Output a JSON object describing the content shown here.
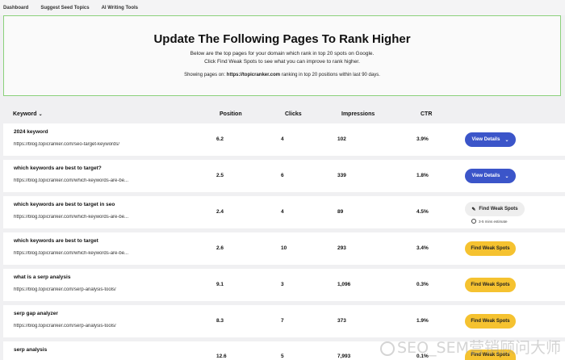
{
  "nav": {
    "items": [
      "Dashboard",
      "Suggest Seed Topics",
      "AI Writing Tools"
    ]
  },
  "hero": {
    "title": "Update The Following Pages To Rank Higher",
    "line1": "Below are the top pages for your domain which rank in top 20 spots on Google.",
    "line2": "Click Find Weak Spots to see what you can improve to rank higher.",
    "filter_prefix": "Showing pages on:",
    "filter_domain": "https://topicranker.com",
    "filter_suffix": "ranking in top 20 positions within last 90 days."
  },
  "table": {
    "headers": {
      "keyword": "Keyword",
      "position": "Position",
      "clicks": "Clicks",
      "impressions": "Impressions",
      "ctr": "CTR"
    },
    "rows": [
      {
        "keyword": "2024 keyword",
        "url": "https://blog.topicranker.com/seo-target-keywords/",
        "position": "6.2",
        "clicks": "4",
        "impressions": "102",
        "ctr": "3.9%",
        "action": "View Details",
        "style": "blue"
      },
      {
        "keyword": "which keywords are best to target?",
        "url": "https://blog.topicranker.com/which-keywords-are-be...",
        "position": "2.5",
        "clicks": "6",
        "impressions": "339",
        "ctr": "1.8%",
        "action": "View Details",
        "style": "blue"
      },
      {
        "keyword": "which keywords are best to target in seo",
        "url": "https://blog.topicranker.com/which-keywords-are-be...",
        "position": "2.4",
        "clicks": "4",
        "impressions": "89",
        "ctr": "4.5%",
        "action": "Find Weak Spots",
        "style": "gray",
        "estimate": "3-5 mins estimate"
      },
      {
        "keyword": "which keywords are best to target",
        "url": "https://blog.topicranker.com/which-keywords-are-be...",
        "position": "2.6",
        "clicks": "10",
        "impressions": "293",
        "ctr": "3.4%",
        "action": "Find Weak Spots",
        "style": "yellow"
      },
      {
        "keyword": "what is a serp analysis",
        "url": "https://blog.topicranker.com/serp-analysis-tools/",
        "position": "9.1",
        "clicks": "3",
        "impressions": "1,096",
        "ctr": "0.3%",
        "action": "Find Weak Spots",
        "style": "yellow"
      },
      {
        "keyword": "serp gap analyzer",
        "url": "https://blog.topicranker.com/serp-analysis-tools/",
        "position": "8.3",
        "clicks": "7",
        "impressions": "373",
        "ctr": "1.9%",
        "action": "Find Weak Spots",
        "style": "yellow"
      },
      {
        "keyword": "serp analysis",
        "url": "",
        "position": "12.6",
        "clicks": "5",
        "impressions": "7,993",
        "ctr": "0.1%",
        "action": "Find Weak Spots",
        "style": "yellow"
      }
    ]
  },
  "watermark": "SEO_SEM营销顾问大师",
  "colors": {
    "accent_blue": "#3b55c9",
    "accent_yellow": "#f5c230",
    "hero_border": "#8bd17b"
  },
  "icons": {
    "sort": "chevron-down-icon",
    "details": "chevron-down-icon",
    "pending": "pencil-icon",
    "estimate": "clock-icon",
    "watermark_logo": "weibo-logo"
  }
}
